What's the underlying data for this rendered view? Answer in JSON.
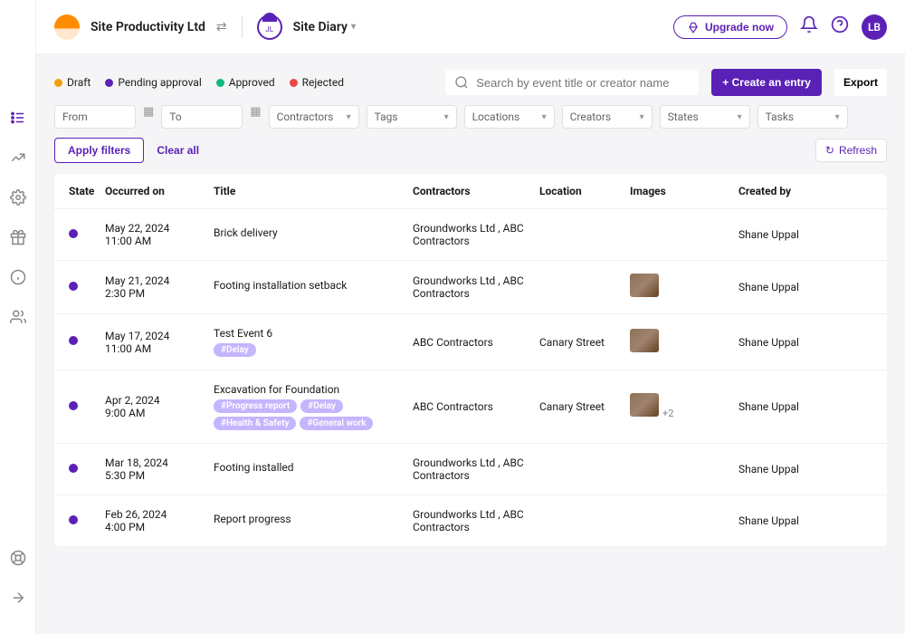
{
  "header": {
    "company": "Site Productivity Ltd",
    "section": "Site Diary"
  },
  "topbar": {
    "upgrade": "Upgrade now",
    "avatar": "LB"
  },
  "legend": {
    "draft": "Draft",
    "pending": "Pending approval",
    "approved": "Approved",
    "rejected": "Rejected"
  },
  "colors": {
    "draft": "#f59e0b",
    "pending": "#5b21b6",
    "approved": "#10b981",
    "rejected": "#ef4444"
  },
  "search": {
    "placeholder": "Search by event title or creator name"
  },
  "buttons": {
    "create": "+ Create an entry",
    "export": "Export",
    "apply": "Apply filters",
    "clear": "Clear all",
    "refresh": "Refresh"
  },
  "filters": {
    "from": "From",
    "to": "To",
    "contractors": "Contractors",
    "tags": "Tags",
    "locations": "Locations",
    "creators": "Creators",
    "states": "States",
    "tasks": "Tasks"
  },
  "columns": {
    "state": "State",
    "occurred": "Occurred on",
    "title": "Title",
    "contractors": "Contractors",
    "location": "Location",
    "images": "Images",
    "creator": "Created by"
  },
  "rows": [
    {
      "date": "May 22, 2024",
      "time": "11:00 AM",
      "title": "Brick delivery",
      "tags": [],
      "contractors": "Groundworks Ltd , ABC Contractors",
      "location": "",
      "thumb": false,
      "extra": "",
      "creator": "Shane Uppal"
    },
    {
      "date": "May 21, 2024",
      "time": "2:30 PM",
      "title": "Footing installation setback",
      "tags": [],
      "contractors": "Groundworks Ltd , ABC Contractors",
      "location": "",
      "thumb": true,
      "extra": "",
      "creator": "Shane Uppal"
    },
    {
      "date": "May 17, 2024",
      "time": "11:00 AM",
      "title": "Test Event 6",
      "tags": [
        "#Delay"
      ],
      "contractors": "ABC Contractors",
      "location": "Canary Street",
      "thumb": true,
      "extra": "",
      "creator": "Shane Uppal"
    },
    {
      "date": "Apr 2, 2024",
      "time": "9:00 AM",
      "title": "Excavation for Foundation",
      "tags": [
        "#Progress report",
        "#Delay",
        "#Health & Safety",
        "#General work"
      ],
      "contractors": "ABC Contractors",
      "location": "Canary Street",
      "thumb": true,
      "extra": "+2",
      "creator": "Shane Uppal"
    },
    {
      "date": "Mar 18, 2024",
      "time": "5:30 PM",
      "title": "Footing installed",
      "tags": [],
      "contractors": "Groundworks Ltd , ABC Contractors",
      "location": "",
      "thumb": false,
      "extra": "",
      "creator": "Shane Uppal"
    },
    {
      "date": "Feb 26, 2024",
      "time": "4:00 PM",
      "title": "Report progress",
      "tags": [],
      "contractors": "Groundworks Ltd , ABC Contractors",
      "location": "",
      "thumb": false,
      "extra": "",
      "creator": "Shane Uppal"
    }
  ]
}
